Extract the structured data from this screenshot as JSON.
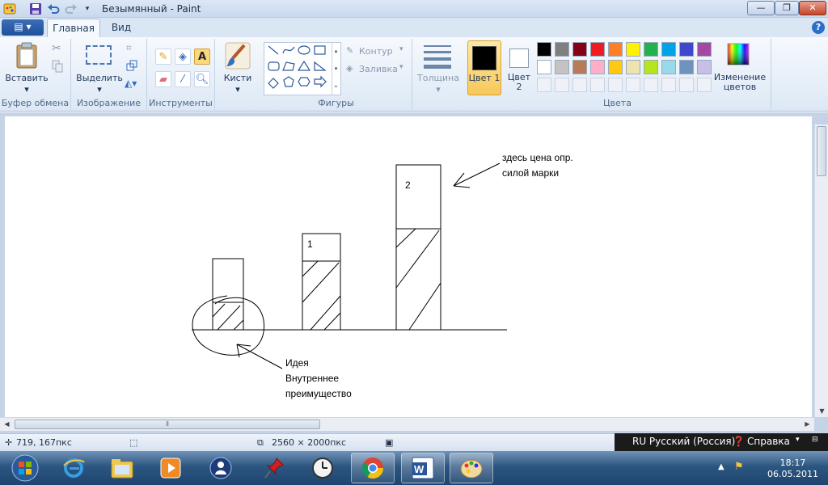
{
  "window": {
    "title": "Безымянный - Paint",
    "controls": {
      "minimize": "—",
      "maximize": "❐",
      "close": "✕"
    }
  },
  "tabs": {
    "file_menu": "▤ ▾",
    "home": "Главная",
    "view": "Вид",
    "help": "?"
  },
  "ribbon": {
    "clipboard": {
      "paste": "Вставить",
      "group": "Буфер обмена"
    },
    "image": {
      "select": "Выделить",
      "group": "Изображение"
    },
    "tools": {
      "group": "Инструменты"
    },
    "brushes": {
      "label": "Кисти"
    },
    "shapes": {
      "outline": "Контур",
      "fill": "Заливка",
      "group": "Фигуры"
    },
    "size": {
      "label": "Толщина"
    },
    "colors": {
      "color1": "Цвет 1",
      "color2": "Цвет 2",
      "edit": "Изменение цветов",
      "group": "Цвета",
      "color1_value": "#000000",
      "color2_value": "#ffffff",
      "palette_row1": [
        "#000000",
        "#7f7f7f",
        "#880015",
        "#ed1c24",
        "#ff7f27",
        "#fff200",
        "#22b14c",
        "#00a2e8",
        "#3f48cc",
        "#a349a4"
      ],
      "palette_row2": [
        "#ffffff",
        "#c3c3c3",
        "#b97a57",
        "#ffaec9",
        "#ffc90e",
        "#efe4b0",
        "#b5e61d",
        "#99d9ea",
        "#7092be",
        "#c8bfe7"
      ]
    }
  },
  "canvas": {
    "label1": "1",
    "label2": "2",
    "note_price": "здесь цена опр.",
    "note_brand": "силой марки",
    "note_idea": "Идея",
    "note_inner": "Внутреннее",
    "note_advantage": "преимущество"
  },
  "status": {
    "cursor": "719, 167пкс",
    "image_size": "2560 × 2000пкс",
    "language": "RU Русский (Россия)",
    "help": "Справка"
  },
  "taskbar": {
    "time": "18:17",
    "date": "06.05.2011"
  }
}
